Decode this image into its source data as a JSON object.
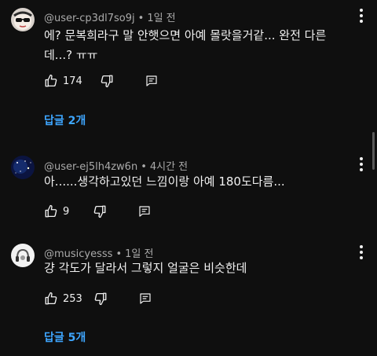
{
  "colors": {
    "background": "#0f0f0f",
    "text": "#f1f1f1",
    "meta": "#aaaaaa",
    "link": "#3ea6ff"
  },
  "comments": [
    {
      "author": "@user-cp3dl7so9j",
      "time": "1일 전",
      "text_lines": [
        "에? 문복희라구 말 안햇으면 아예 몰랏을거같... 완전 다른",
        "데...? ㅠㅠ"
      ],
      "likes": "174",
      "replies_label": "답글 2개",
      "avatar_icon": "cartoon-face-sunglasses-avatar"
    },
    {
      "author": "@user-ej5lh4zw6n",
      "time": "4시간 전",
      "text_lines": [
        "아......생각하고있던 느낌이랑 아예 180도다름..."
      ],
      "likes": "9",
      "replies_label": "",
      "avatar_icon": "starry-night-avatar"
    },
    {
      "author": "@musicyesss",
      "time": "1일 전",
      "text_lines": [
        "걍 각도가 달라서 그렇지 얼굴은 비슷한데"
      ],
      "likes": "253",
      "replies_label": "답글 5개",
      "avatar_icon": "headphones-avatar"
    }
  ],
  "icons": {
    "like": "thumbs-up-icon",
    "dislike": "thumbs-down-icon",
    "reply": "reply-comment-icon",
    "more": "more-vertical-icon"
  }
}
